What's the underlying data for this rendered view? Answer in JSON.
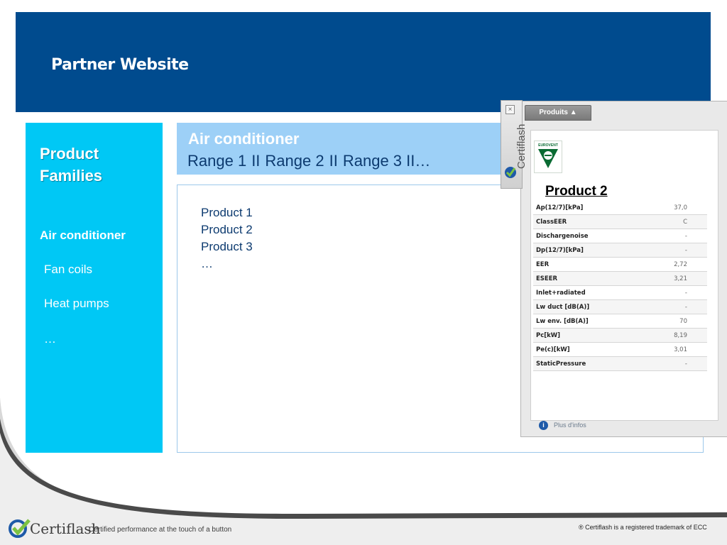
{
  "header": {
    "title": "Partner Website"
  },
  "sidebar": {
    "title": "Product Families",
    "items": [
      {
        "label": "Air conditioner",
        "active": true
      },
      {
        "label": "Fan coils",
        "active": false
      },
      {
        "label": "Heat pumps",
        "active": false
      },
      {
        "label": "…",
        "active": false
      }
    ]
  },
  "main": {
    "heading": "Air conditioner",
    "ranges": [
      "Range 1",
      "Range 2",
      "Range 3",
      "II…"
    ],
    "separator": "II",
    "products": [
      "Product 1",
      "Product 2",
      "Product 3",
      "…"
    ]
  },
  "widget": {
    "vertical_brand": "Certiflash",
    "close_label": "×",
    "tab_label": "Produits ▲",
    "logo_text": "EUROVENT",
    "product_title": "Product 2",
    "specs": [
      {
        "key": "Ap(12/7)[kPa]",
        "value": "37,0"
      },
      {
        "key": "ClassEER",
        "value": "C"
      },
      {
        "key": "Dischargenoise",
        "value": "-"
      },
      {
        "key": "Dp(12/7)[kPa]",
        "value": "-"
      },
      {
        "key": "EER",
        "value": "2,72"
      },
      {
        "key": "ESEER",
        "value": "3,21"
      },
      {
        "key": "Inlet+radiated",
        "value": "-"
      },
      {
        "key": "Lw duct [dB(A)]",
        "value": "-"
      },
      {
        "key": "Lw env. [dB(A)]",
        "value": "70"
      },
      {
        "key": "Pc[kW]",
        "value": "8,19"
      },
      {
        "key": "Pe(c)[kW]",
        "value": "3,01"
      },
      {
        "key": "StaticPressure",
        "value": "-"
      }
    ],
    "more_info": "Plus d'infos",
    "info_icon": "i"
  },
  "footer": {
    "brand": "Certiflash",
    "tagline": "Certified performance at the touch of a button",
    "trademark": "® Certiflash is a registered trademark of ECC"
  },
  "colors": {
    "header_bg": "#004b8e",
    "sidebar_bg": "#00c8f5",
    "range_bar_bg": "#9dd0f7",
    "brand_green": "#2e9a3f"
  }
}
